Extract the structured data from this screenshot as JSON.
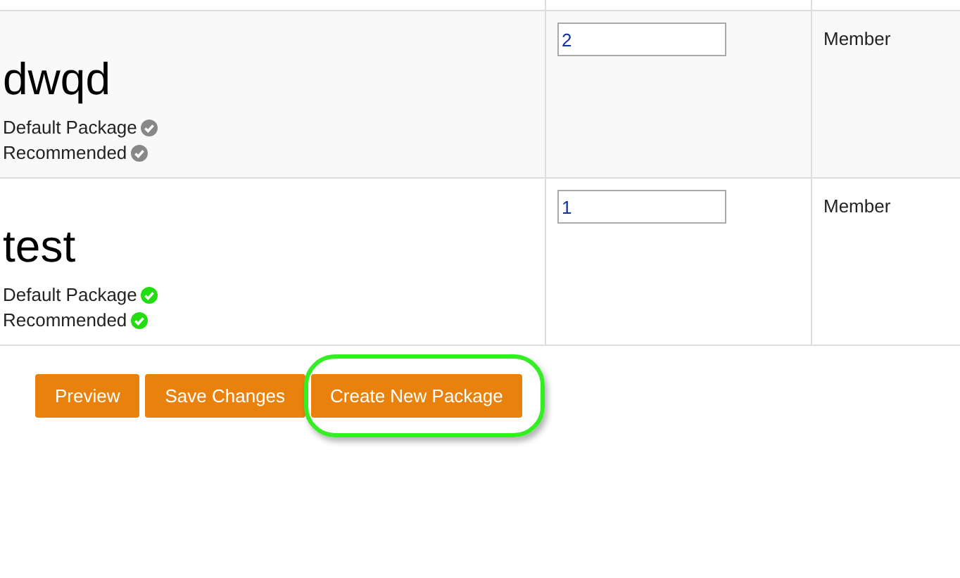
{
  "packages": [
    {
      "name": "dwqd",
      "order": "2",
      "role": "Member",
      "flags": [
        {
          "label": "Default Package",
          "on": false
        },
        {
          "label": "Recommended",
          "on": false
        }
      ]
    },
    {
      "name": "test",
      "order": "1",
      "role": "Member",
      "flags": [
        {
          "label": "Default Package",
          "on": true
        },
        {
          "label": "Recommended",
          "on": true
        }
      ]
    }
  ],
  "buttons": [
    {
      "label": "Preview",
      "highlighted": false
    },
    {
      "label": "Save Changes",
      "highlighted": false
    },
    {
      "label": "Create New Package",
      "highlighted": true
    }
  ]
}
